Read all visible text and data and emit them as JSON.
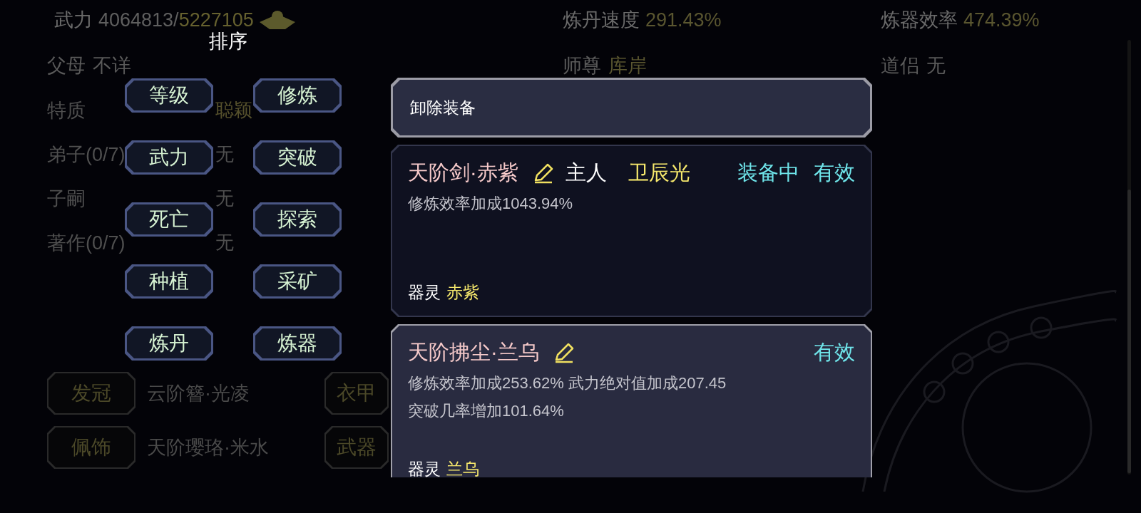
{
  "top_stats": [
    {
      "kind": "power",
      "label": "武力",
      "value": "4064813/",
      "max": "5227105"
    },
    {
      "kind": "plain",
      "label": "炼丹速度",
      "value": "291.43%"
    },
    {
      "kind": "plain",
      "label": "炼器效率",
      "value": "474.39%"
    }
  ],
  "relations": [
    {
      "label": "父母",
      "value": "不详",
      "highlight": false
    },
    {
      "label": "师尊",
      "value": "库岸",
      "highlight": true
    },
    {
      "label": "道侣",
      "value": "无",
      "highlight": false
    }
  ],
  "attributes": [
    {
      "label": "特质",
      "value": "聪颖",
      "highlight": true
    },
    {
      "label": "弟子(0/7)",
      "value": "无",
      "highlight": false
    },
    {
      "label": "子嗣",
      "value": "无",
      "highlight": false
    },
    {
      "label": "著作(0/7)",
      "value": "无",
      "highlight": false
    }
  ],
  "slots": [
    {
      "label": "发冠",
      "item": "云阶簪·光凌"
    },
    {
      "label": "衣甲"
    },
    {
      "label": "佩饰",
      "item": "天阶璎珞·米水"
    },
    {
      "label": "武器"
    }
  ],
  "sort_menu": {
    "title": "排序",
    "options": [
      "等级",
      "修炼",
      "武力",
      "突破",
      "死亡",
      "探索",
      "种植",
      "采矿",
      "炼丹",
      "炼器"
    ]
  },
  "equipment_panel": {
    "unequip_button": "卸除装备",
    "items": [
      {
        "name": "天阶剑·赤紫",
        "owner_label": "主人",
        "owner": "卫辰光",
        "status": "装备中",
        "validity": "有效",
        "effects": [
          "修炼效率加成1043.94%"
        ],
        "spirit_label": "器灵",
        "spirit": "赤紫",
        "equipped": true
      },
      {
        "name": "天阶拂尘·兰乌",
        "validity": "有效",
        "effects": [
          "修炼效率加成253.62% 武力绝对值加成207.45",
          "突破几率增加101.64%"
        ],
        "spirit_label": "器灵",
        "spirit": "兰乌",
        "equipped": false
      }
    ]
  }
}
